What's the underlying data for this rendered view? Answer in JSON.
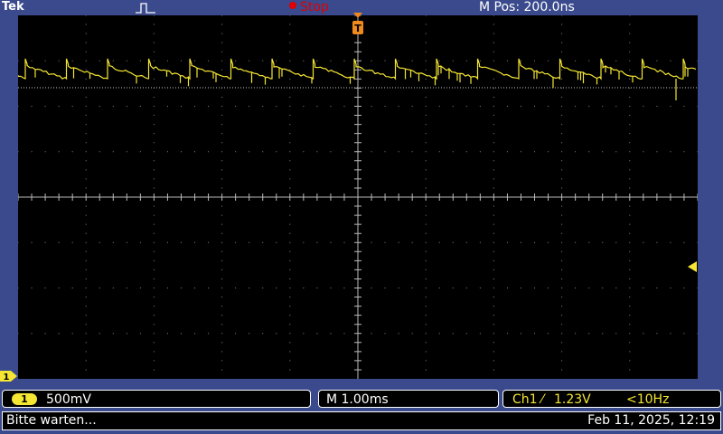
{
  "header": {
    "brand": "Tek",
    "acq_state": "Stop",
    "horizontal_position": "M Pos: 200.0ns"
  },
  "channel": {
    "badge": "1",
    "marker": "1",
    "volts_per_div": "500mV"
  },
  "timebase": {
    "label": "M 1.00ms"
  },
  "trigger": {
    "source": "Ch1",
    "edge_symbol": "⁄",
    "level": "1.23V",
    "frequency": "<10Hz",
    "marker_symbol": "T"
  },
  "status": {
    "message": "Bitte warten...",
    "datetime": "Feb 11, 2025, 12:19"
  },
  "colors": {
    "trace": "#f5e633",
    "stop": "#e00000",
    "trigger_marker": "#f08a1c",
    "frame": "#3a4a8c"
  },
  "icons": {
    "trigger_type": "rising-edge-pulse-icon",
    "trigger_position": "trigger-position-icon",
    "trigger_level": "trigger-level-arrow-icon"
  }
}
